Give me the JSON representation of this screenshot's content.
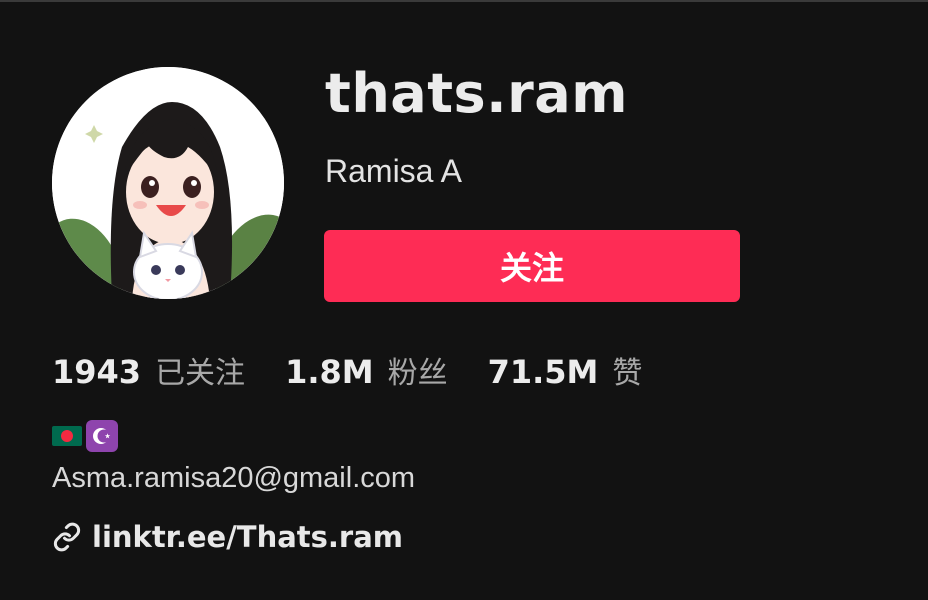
{
  "profile": {
    "username": "thats.ram",
    "display_name": "Ramisa A",
    "follow_label": "关注",
    "avatar_icon": "anime-girl-with-cat-avatar"
  },
  "stats": [
    {
      "value": "1943",
      "label": "已关注"
    },
    {
      "value": "1.8M",
      "label": "粉丝"
    },
    {
      "value": "71.5M",
      "label": "赞"
    }
  ],
  "bio": {
    "emojis": [
      "bangladesh-flag-icon",
      "star-and-crescent-icon"
    ],
    "text": "Asma.ramisa20@gmail.com"
  },
  "link": {
    "icon": "link-icon",
    "text": "linktr.ee/Thats.ram"
  },
  "colors": {
    "background": "#121212",
    "accent": "#fe2c55",
    "text_primary": "#ececec",
    "text_secondary": "#a8a8a8"
  }
}
